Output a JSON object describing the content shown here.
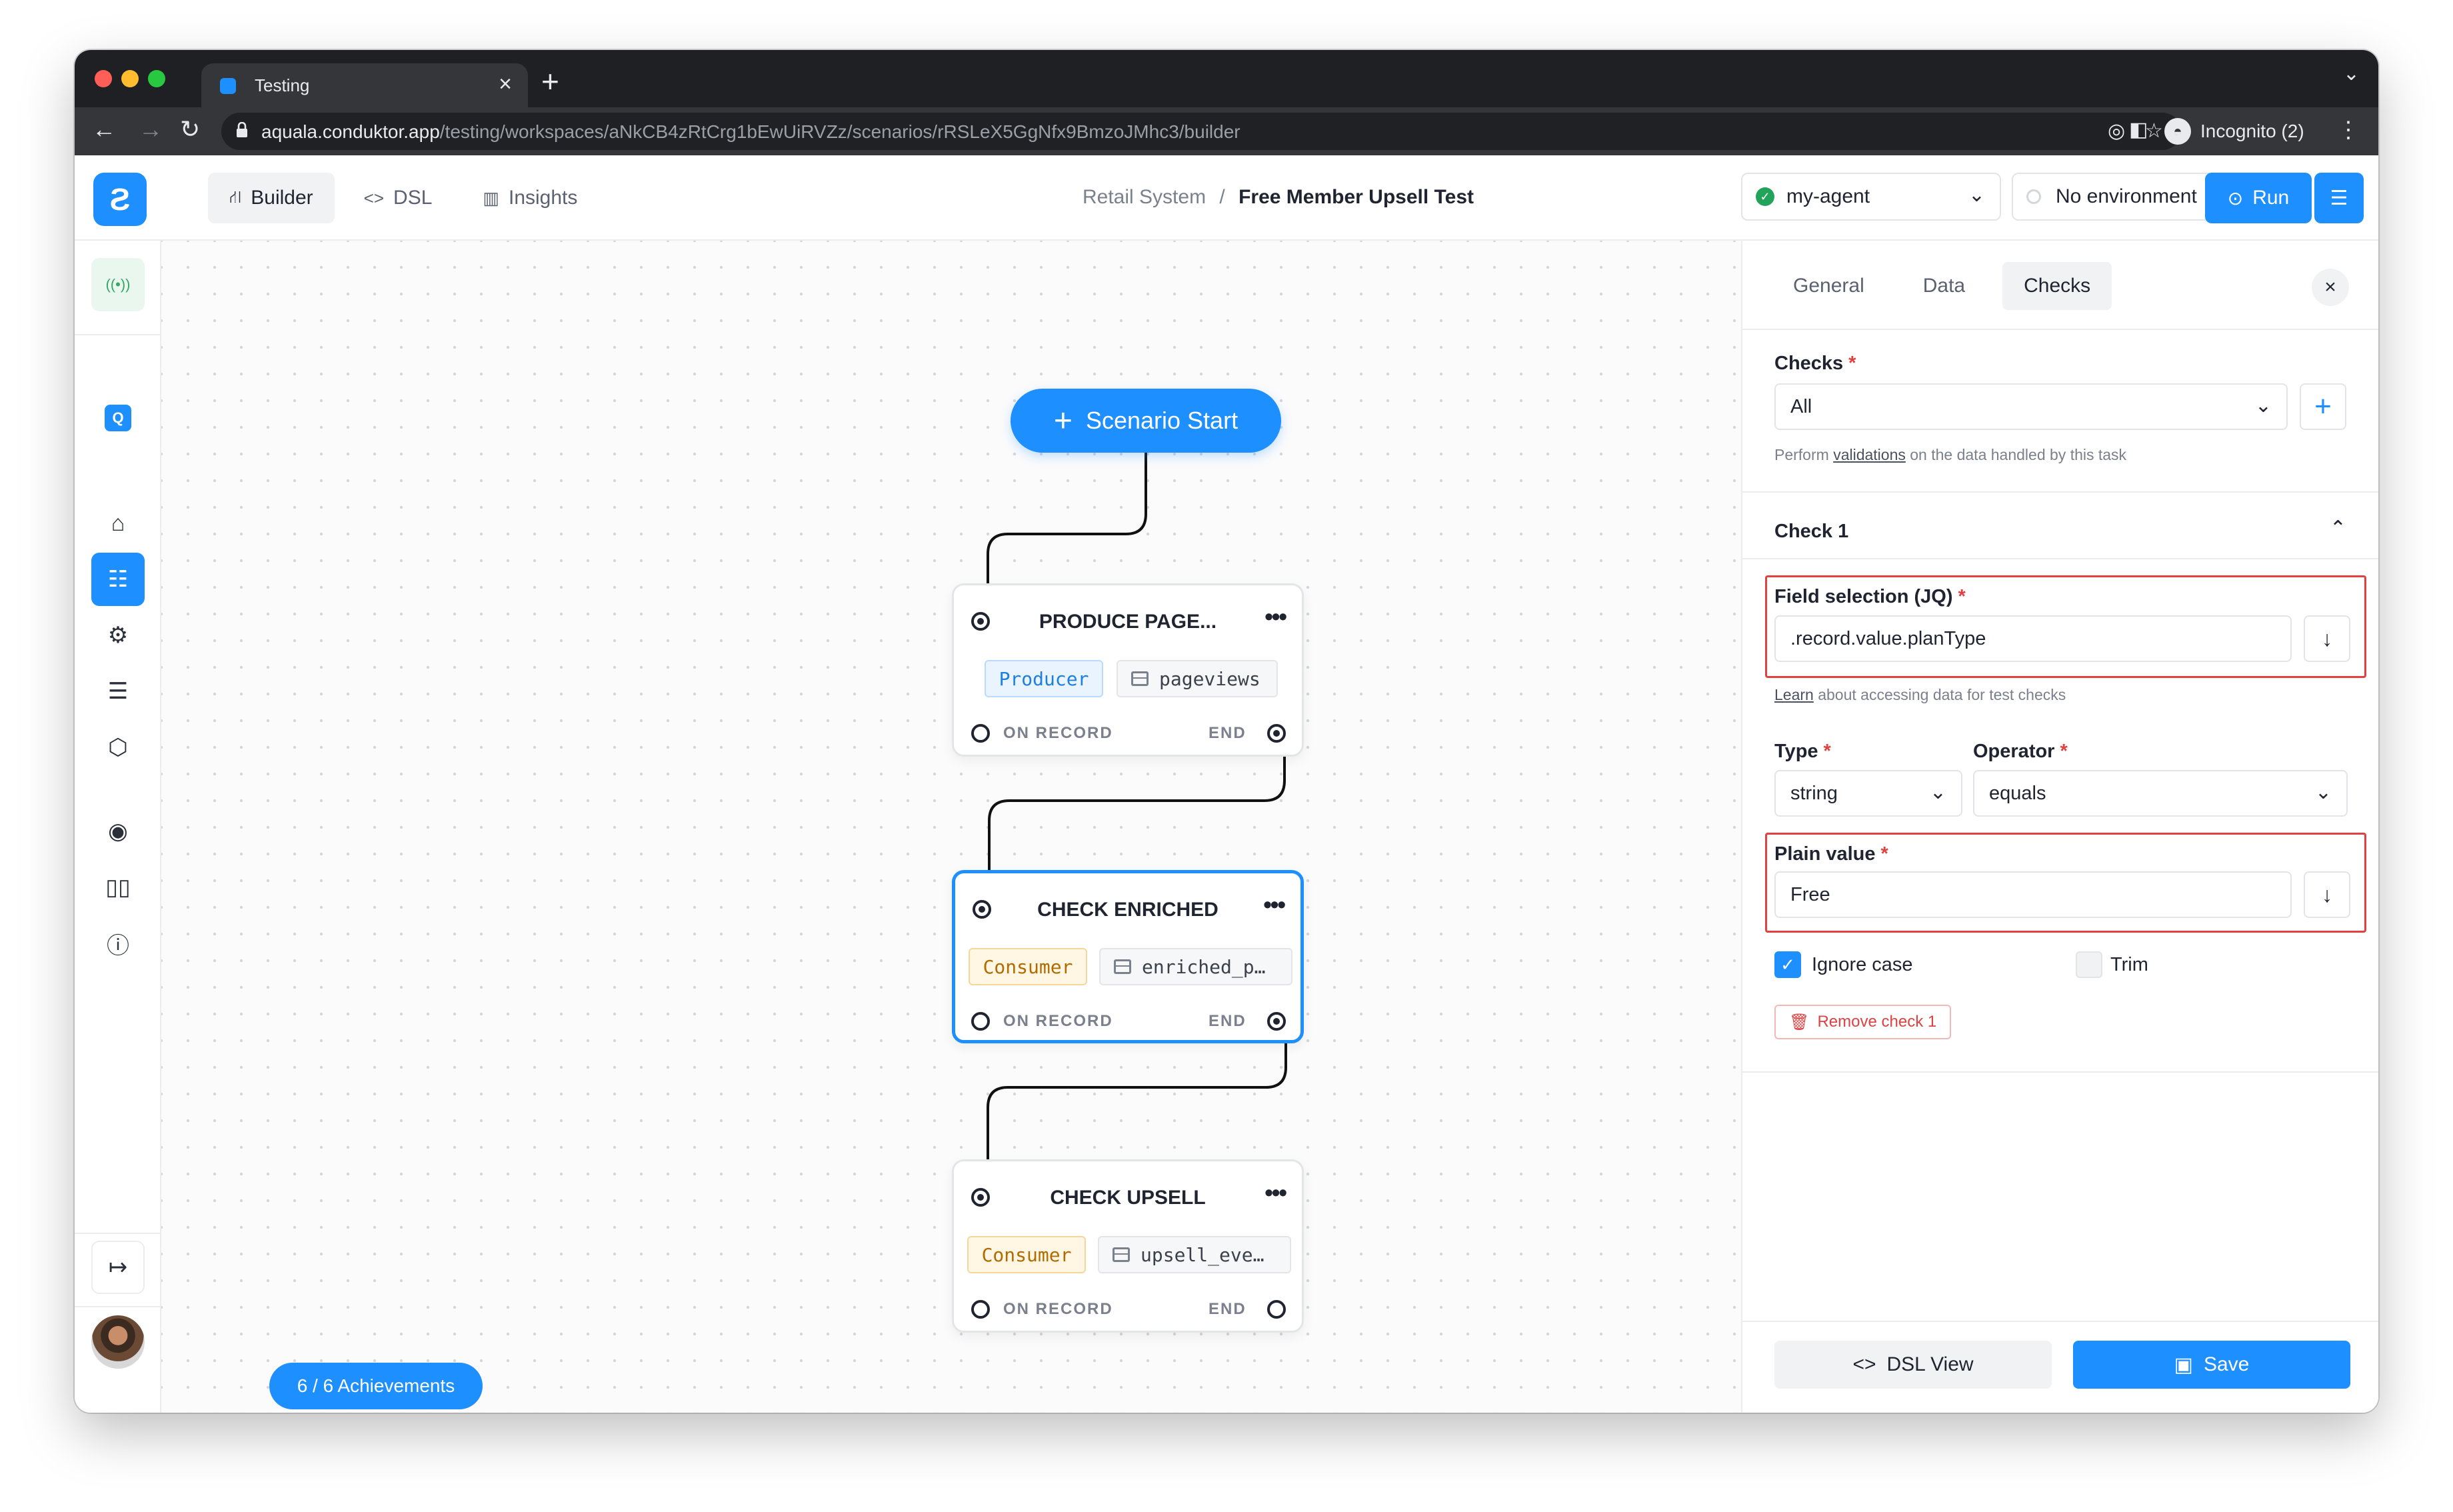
{
  "browser": {
    "tab_title": "Testing",
    "url_host": "aquala.conduktor.app",
    "url_path": "/testing/workspaces/aNkCB4zRtCrg1bEwUiRVZz/scenarios/rRSLeX5GgNfx9BmzoJMhc3/builder",
    "incognito_label": "Incognito (2)"
  },
  "topnav": {
    "builder": "Builder",
    "dsl": "DSL",
    "insights": "Insights"
  },
  "breadcrumb": {
    "parent": "Retail System",
    "separator": "/",
    "current": "Free Member Upsell Test"
  },
  "agent_select": {
    "value": "my-agent"
  },
  "environment_select": {
    "value": "No environment"
  },
  "run_button": {
    "label": "Run"
  },
  "canvas": {
    "start_label": "Scenario Start",
    "achievements": "6 / 6 Achievements",
    "nodes": [
      {
        "title": "PRODUCE PAGE...",
        "type": "Producer",
        "topic": "pageviews",
        "on_record": "ON RECORD",
        "end": "END"
      },
      {
        "title": "CHECK ENRICHED",
        "type": "Consumer",
        "topic": "enriched_p…",
        "on_record": "ON RECORD",
        "end": "END"
      },
      {
        "title": "CHECK UPSELL",
        "type": "Consumer",
        "topic": "upsell_eve…",
        "on_record": "ON RECORD",
        "end": "END"
      }
    ]
  },
  "panel": {
    "tabs": {
      "general": "General",
      "data": "Data",
      "checks": "Checks"
    },
    "checks_label": "Checks",
    "checks_value": "All",
    "checks_help_pre": "Perform",
    "checks_help_link": "validations",
    "checks_help_post": "on the data handled by this task",
    "check_title": "Check 1",
    "field_label": "Field selection (JQ)",
    "field_value": ".record.value.planType",
    "field_help_link": "Learn",
    "field_help_post": "about accessing data for test checks",
    "type_label": "Type",
    "type_value": "string",
    "operator_label": "Operator",
    "operator_value": "equals",
    "plain_label": "Plain value",
    "plain_value": "Free",
    "ignore_case": "Ignore case",
    "ignore_case_checked": true,
    "trim": "Trim",
    "trim_checked": false,
    "remove_label": "Remove check 1",
    "dsl_view": "DSL View",
    "save": "Save",
    "required_mark": "*"
  },
  "colors": {
    "accent": "#1d8fff",
    "required": "#e04141",
    "producer": "#1d7fe0",
    "consumer": "#b26b00",
    "agent_ok": "#22a35a"
  }
}
